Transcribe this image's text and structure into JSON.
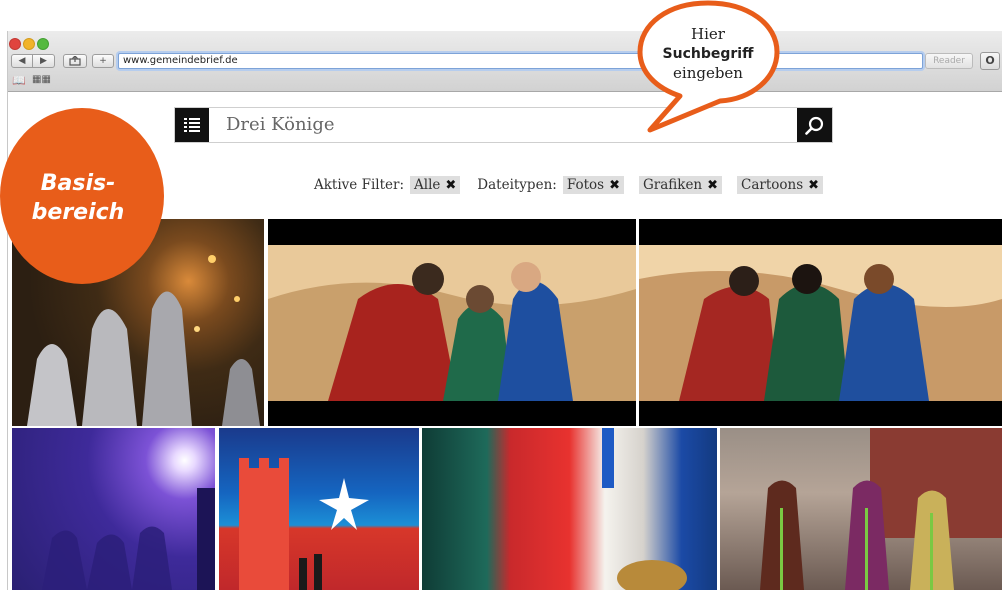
{
  "browser": {
    "url": "www.gemeindebrief.de",
    "reader_label": "Reader",
    "back_glyph": "◀",
    "forward_glyph": "▶",
    "add_glyph": "+"
  },
  "search": {
    "query": "Drei Könige"
  },
  "filters": {
    "active_label": "Aktive Filter:",
    "active_chips": [
      "Alle"
    ],
    "filetypes_label": "Dateitypen:",
    "filetype_chips": [
      "Fotos",
      "Grafiken",
      "Cartoons"
    ],
    "remove_glyph": "✖"
  },
  "badge": {
    "line1": "Basis-",
    "line2": "bereich"
  },
  "callout": {
    "line1": "Hier",
    "line2": "Suchbegriff",
    "line3": "eingeben"
  },
  "colors": {
    "accent_orange": "#e85d1a",
    "dark": "#111111",
    "chip_bg": "#dedede"
  }
}
